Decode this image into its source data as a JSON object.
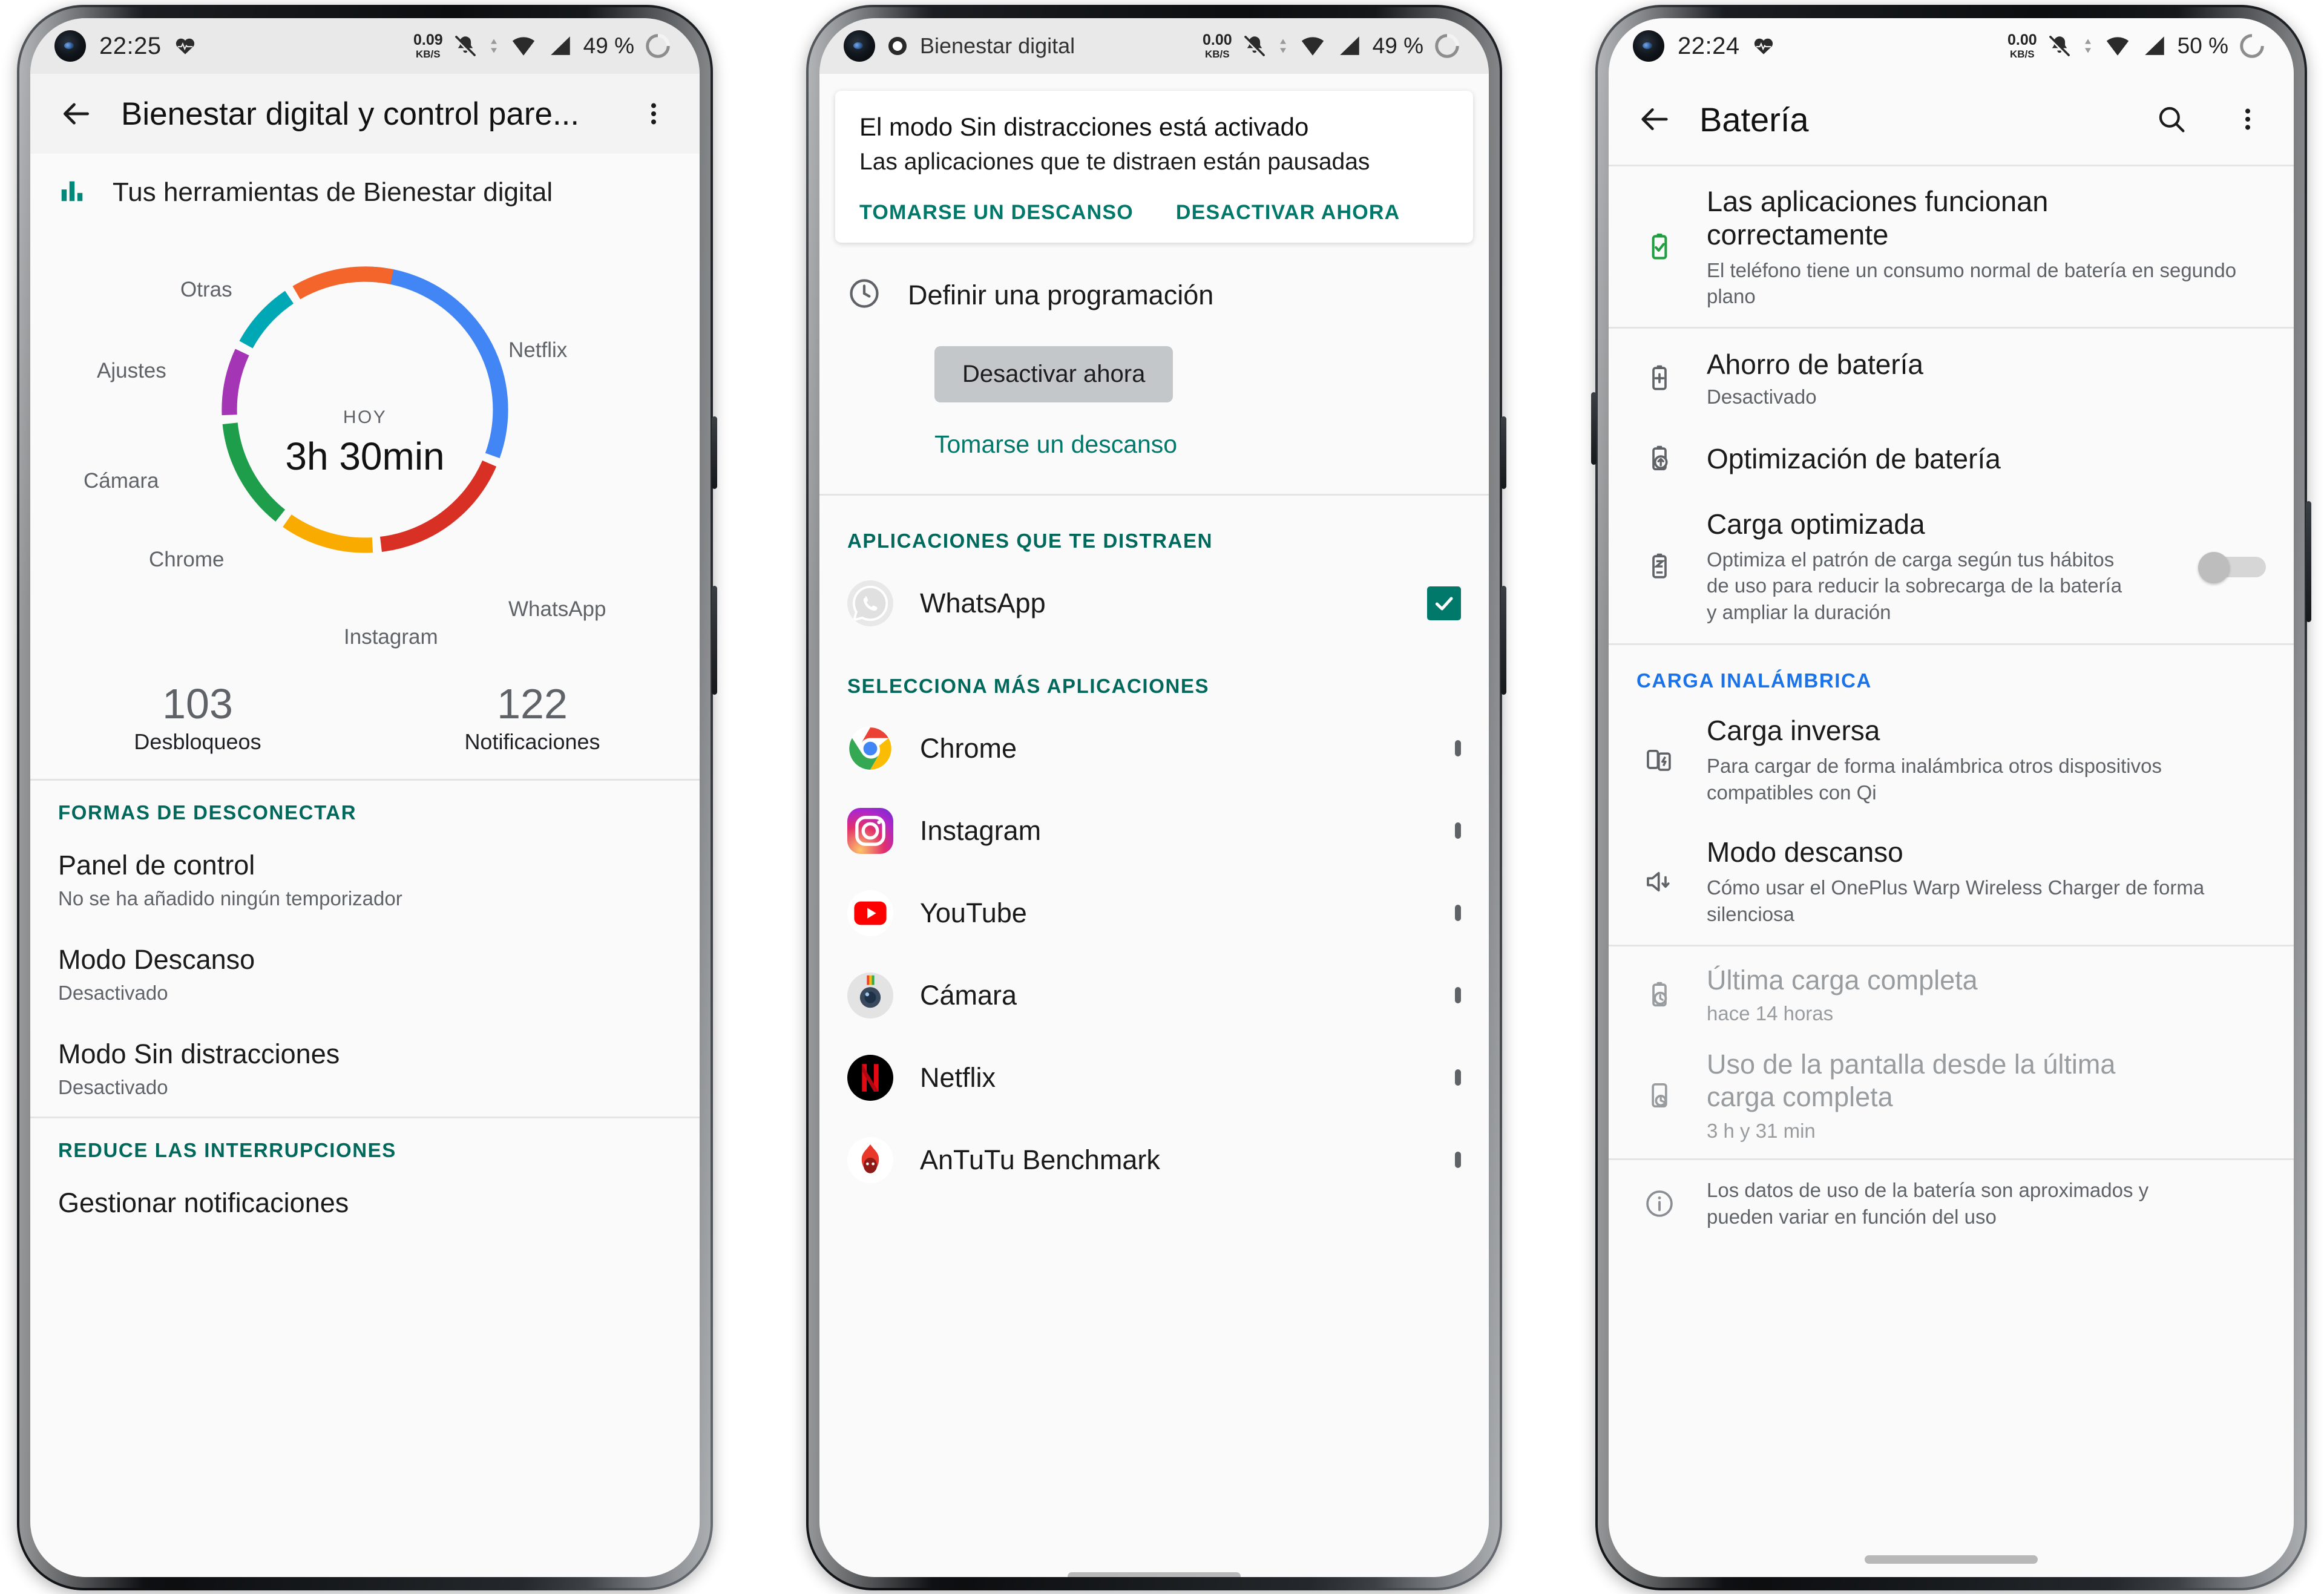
{
  "colors": {
    "teal_accent": "#00695c",
    "green_link": "#00796b",
    "blue_section": "#1a73e8",
    "battery_ok_green": "#1e9e3e",
    "grey_text": "#5f6368"
  },
  "phone1": {
    "statusbar": {
      "time": "22:25",
      "heart_icon": "heartbeat-icon",
      "net_speed_value": "0.09",
      "net_speed_unit": "KB/S",
      "mute_icon": "bell-muted-icon",
      "wifi_icon": "wifi-icon",
      "signal_icon": "cellular-signal-icon",
      "battery_pct": "49 %",
      "battery_icon": "battery-ring-icon"
    },
    "appbar": {
      "back_icon": "back-arrow-icon",
      "title": "Bienestar digital y control pare...",
      "overflow_icon": "more-vertical-icon"
    },
    "tools_header": {
      "icon": "bar-chart-icon",
      "label": "Tus herramientas de Bienestar digital"
    },
    "stats": [
      {
        "number": "103",
        "label": "Desbloqueos"
      },
      {
        "number": "122",
        "label": "Notificaciones"
      }
    ],
    "sections": [
      {
        "label": "FORMAS DE DESCONECTAR",
        "items": [
          {
            "title": "Panel de control",
            "subtitle": "No se ha añadido ningún temporizador"
          },
          {
            "title": "Modo Descanso",
            "subtitle": "Desactivado"
          },
          {
            "title": "Modo Sin distracciones",
            "subtitle": "Desactivado"
          }
        ]
      },
      {
        "label": "REDUCE LAS INTERRUPCIONES",
        "items": [
          {
            "title": "Gestionar notificaciones",
            "subtitle": ""
          }
        ]
      }
    ]
  },
  "chart_data": {
    "type": "pie",
    "title": "HOY",
    "center_label": "HOY",
    "center_value": "3h 30min",
    "total_minutes": 210,
    "categories": [
      "Netflix",
      "WhatsApp",
      "Instagram",
      "Chrome",
      "Cámara",
      "Ajustes",
      "Otras"
    ],
    "values": [
      31,
      17,
      11,
      13,
      8,
      8,
      12
    ],
    "unit": "percent",
    "colors": [
      "#4285f4",
      "#d93025",
      "#f9ab00",
      "#1e9e4a",
      "#a435b5",
      "#00a7b5",
      "#f4652b"
    ],
    "labels_position": "outside",
    "legend": "none",
    "grid": false
  },
  "phone2": {
    "statusbar": {
      "app_icon": "digital-wellbeing-icon",
      "app_name": "Bienestar digital",
      "net_speed_value": "0.00",
      "net_speed_unit": "KB/S",
      "mute_icon": "bell-muted-icon",
      "wifi_icon": "wifi-icon",
      "signal_icon": "cellular-signal-icon",
      "battery_pct": "49 %",
      "battery_icon": "battery-ring-icon"
    },
    "banner": {
      "title": "El modo Sin distracciones está activado",
      "subtitle": "Las aplicaciones que te distraen están pausadas",
      "action_left": "TOMARSE UN DESCANSO",
      "action_right": "DESACTIVAR AHORA"
    },
    "schedule": {
      "icon": "clock-icon",
      "label": "Definir una programación"
    },
    "turn_off_button": "Desactivar ahora",
    "break_link": "Tomarse un descanso",
    "distracting_label": "APLICACIONES QUE TE DISTRAEN",
    "distracting_apps": [
      {
        "name": "WhatsApp",
        "icon": "whatsapp-icon",
        "checked": true
      }
    ],
    "more_apps_label": "SELECCIONA MÁS APLICACIONES",
    "more_apps": [
      {
        "name": "Chrome",
        "icon": "chrome-icon",
        "checked": false
      },
      {
        "name": "Instagram",
        "icon": "instagram-icon",
        "checked": false
      },
      {
        "name": "YouTube",
        "icon": "youtube-icon",
        "checked": false
      },
      {
        "name": "Cámara",
        "icon": "camera-icon",
        "checked": false
      },
      {
        "name": "Netflix",
        "icon": "netflix-icon",
        "checked": false
      },
      {
        "name": "AnTuTu Benchmark",
        "icon": "antutu-icon",
        "checked": false
      }
    ]
  },
  "phone3": {
    "statusbar": {
      "time": "22:24",
      "heart_icon": "heartbeat-icon",
      "net_speed_value": "0.00",
      "net_speed_unit": "KB/S",
      "mute_icon": "bell-muted-icon",
      "wifi_icon": "wifi-icon",
      "signal_icon": "cellular-signal-icon",
      "battery_pct": "50 %",
      "battery_icon": "battery-ring-icon"
    },
    "appbar": {
      "back_icon": "back-arrow-icon",
      "title": "Batería",
      "search_icon": "search-icon",
      "overflow_icon": "more-vertical-icon"
    },
    "status_item": {
      "icon": "battery-check-icon",
      "title_line1": "Las aplicaciones funcionan",
      "title_line2": "correctamente",
      "subtitle": "El teléfono tiene un consumo normal de batería en segundo plano"
    },
    "items": [
      {
        "icon": "battery-saver-icon",
        "title": "Ahorro de batería",
        "subtitle": "Desactivado"
      },
      {
        "icon": "battery-optimize-icon",
        "title": "Optimización de batería",
        "subtitle": ""
      },
      {
        "icon": "battery-charge-icon",
        "title": "Carga optimizada",
        "subtitle": "Optimiza el patrón de carga según tus hábitos de uso para reducir la sobrecarga de la batería y ampliar la duración",
        "toggle": "off"
      }
    ],
    "wireless_label": "CARGA INALÁMBRICA",
    "wireless_items": [
      {
        "icon": "reverse-charge-icon",
        "title": "Carga inversa",
        "subtitle": "Para cargar de forma inalámbrica otros dispositivos compatibles con Qi"
      },
      {
        "icon": "volume-down-icon",
        "title": "Modo descanso",
        "subtitle": "Cómo usar el OnePlus Warp Wireless Charger de forma silenciosa"
      }
    ],
    "history_items": [
      {
        "icon": "battery-clock-icon",
        "title": "Última carga completa",
        "subtitle": "hace 14 horas"
      },
      {
        "icon": "screen-time-icon",
        "title": "Uso de la pantalla desde la última carga completa",
        "subtitle": "3 h y 31 min"
      }
    ],
    "footer": {
      "icon": "info-icon",
      "text": "Los datos de uso de la batería son aproximados y pueden variar en función del uso"
    }
  }
}
